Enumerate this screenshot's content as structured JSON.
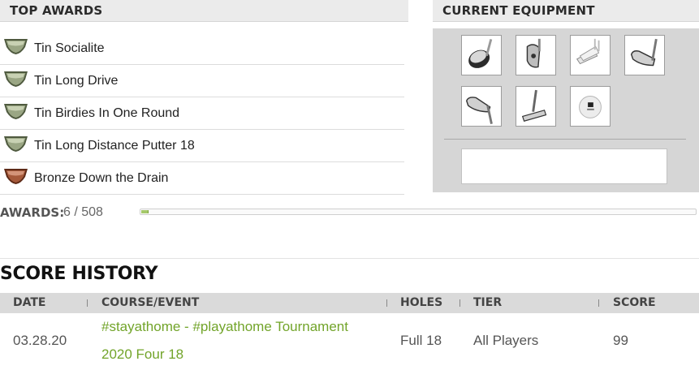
{
  "top_awards": {
    "title": "TOP AWARDS",
    "items": [
      {
        "label": "Tin Socialite",
        "tier": "tin"
      },
      {
        "label": "Tin Long Drive",
        "tier": "tin"
      },
      {
        "label": "Tin Birdies In One Round",
        "tier": "tin"
      },
      {
        "label": "Tin Long Distance Putter 18",
        "tier": "tin"
      },
      {
        "label": "Bronze Down the Drain",
        "tier": "bronze"
      }
    ],
    "counter_label": "AWARDS:",
    "counter_value": "6 / 508",
    "earned": 6,
    "total": 508
  },
  "current_equipment": {
    "title": "CURRENT EQUIPMENT",
    "items": [
      {
        "icon": "driver-icon"
      },
      {
        "icon": "fairway-wood-icon"
      },
      {
        "icon": "irons-set-icon"
      },
      {
        "icon": "wedge-icon"
      },
      {
        "icon": "wedge-icon"
      },
      {
        "icon": "putter-icon"
      },
      {
        "icon": "golf-ball-icon"
      }
    ]
  },
  "score_history": {
    "title": "SCORE HISTORY",
    "columns": {
      "date": "DATE",
      "course_event": "COURSE/EVENT",
      "holes": "HOLES",
      "tier": "TIER",
      "score": "SCORE"
    },
    "rows": [
      {
        "date": "03.28.20",
        "event_line1": "#stayathome - #playathome Tournament",
        "event_line2": "2020 Four 18",
        "holes": "Full 18",
        "tier": "All Players",
        "score": "99"
      }
    ]
  },
  "colors": {
    "tin": "#8e9a79",
    "bronze": "#a2583b",
    "link": "#72a42a",
    "progress": "#a5c86a"
  }
}
